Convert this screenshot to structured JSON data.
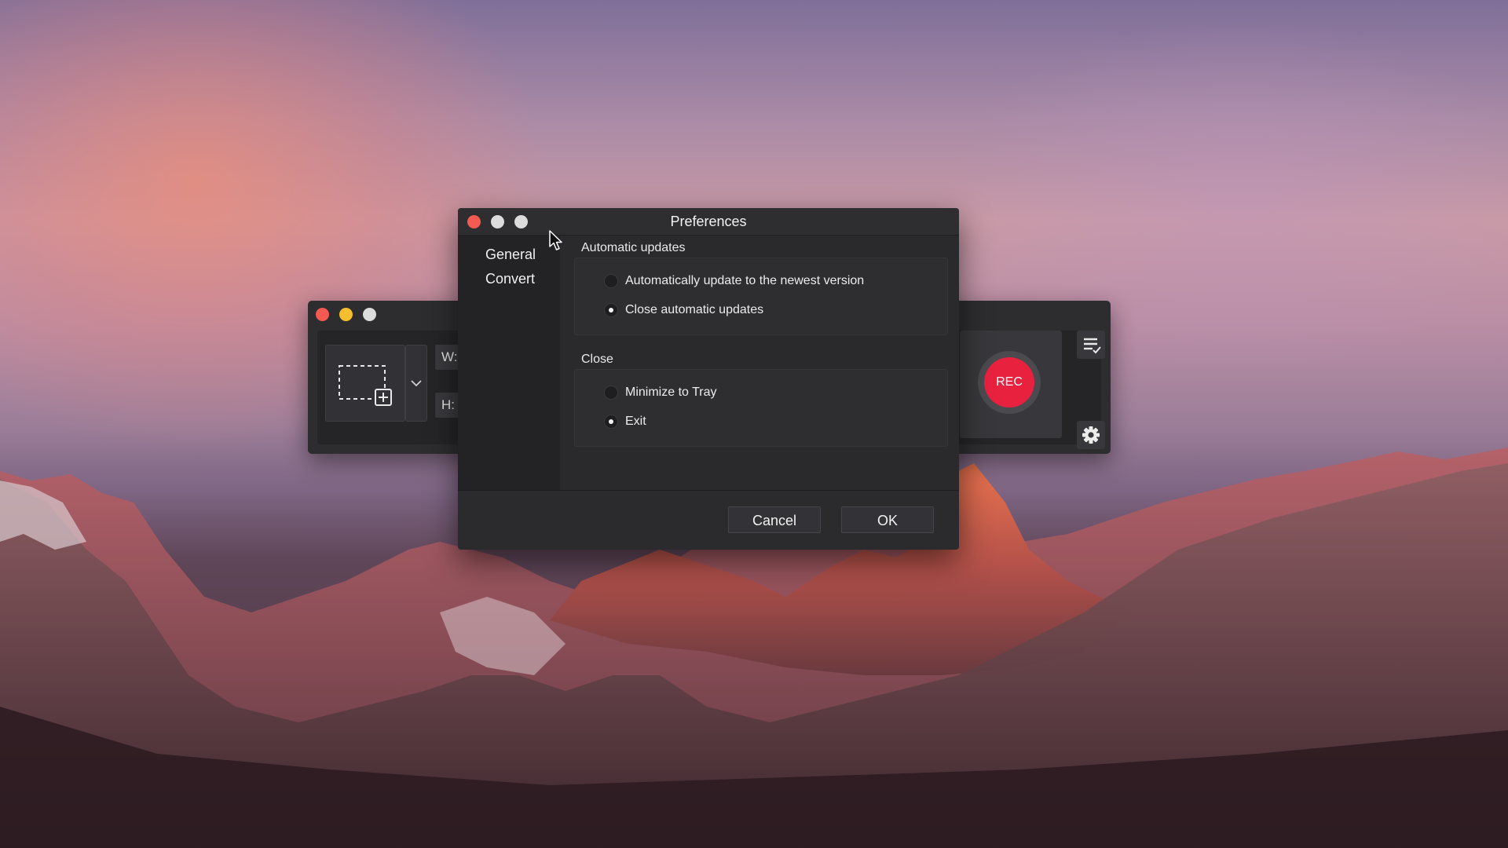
{
  "dialog": {
    "title": "Preferences",
    "sidebar": [
      "General",
      "Convert"
    ],
    "sections": [
      {
        "title": "Automatic updates",
        "options": [
          {
            "label": "Automatically update to the newest version",
            "checked": false
          },
          {
            "label": "Close automatic updates",
            "checked": true
          }
        ]
      },
      {
        "title": "Close",
        "options": [
          {
            "label": "Minimize to Tray",
            "checked": false
          },
          {
            "label": "Exit",
            "checked": true
          }
        ]
      }
    ],
    "buttons": {
      "cancel": "Cancel",
      "ok": "OK"
    }
  },
  "recorder": {
    "width_label": "W:",
    "height_label": "H:",
    "rec_label": "REC"
  },
  "icons": {
    "region": "region-select-icon",
    "dropdown": "chevron-down-icon",
    "list": "task-list-icon",
    "settings": "gear-icon",
    "cursor": "mouse-cursor-icon"
  },
  "colors": {
    "rec": "#e8213f",
    "close": "#f25a52",
    "minimize": "#f5be2d",
    "zoom": "#dcdcdc"
  }
}
